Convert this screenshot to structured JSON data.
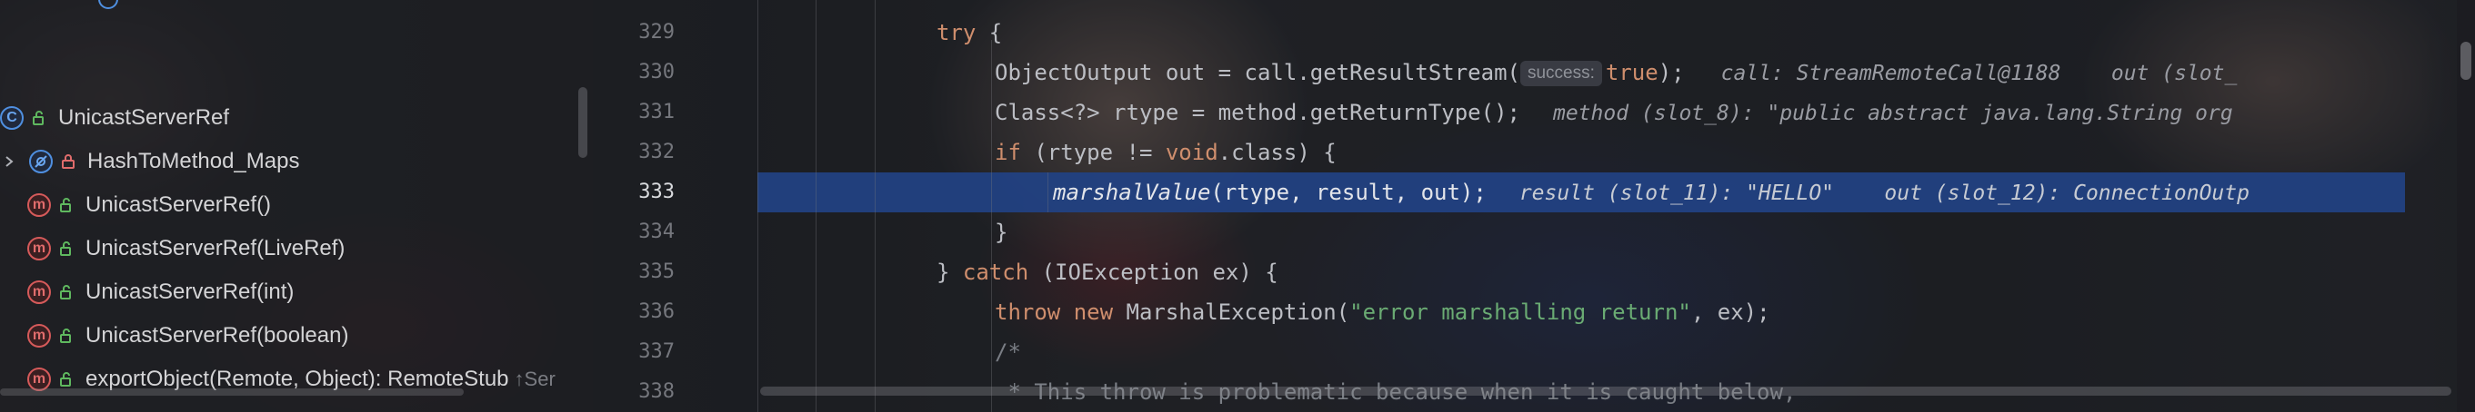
{
  "structure": {
    "top_partial_label": "",
    "items": [
      {
        "kind": "class",
        "badge": "C",
        "label": "UnicastServerRef",
        "suffix": "",
        "chevron": false
      },
      {
        "kind": "field",
        "badge": "f",
        "label": "HashToMethod_Maps",
        "suffix": "",
        "chevron": true
      },
      {
        "kind": "method",
        "badge": "m",
        "label": "UnicastServerRef()",
        "suffix": "",
        "chevron": false
      },
      {
        "kind": "method",
        "badge": "m",
        "label": "UnicastServerRef(LiveRef)",
        "suffix": "",
        "chevron": false
      },
      {
        "kind": "method",
        "badge": "m",
        "label": "UnicastServerRef(int)",
        "suffix": "",
        "chevron": false
      },
      {
        "kind": "method",
        "badge": "m",
        "label": "UnicastServerRef(boolean)",
        "suffix": "",
        "chevron": false
      },
      {
        "kind": "method",
        "badge": "m",
        "label": "exportObject(Remote, Object): RemoteStub",
        "suffix": "↑Ser",
        "chevron": false
      }
    ]
  },
  "editor": {
    "line_numbers": [
      "329",
      "330",
      "331",
      "332",
      "333",
      "334",
      "335",
      "336",
      "337",
      "338"
    ],
    "active_line": "333",
    "lines": {
      "l329": {
        "kw": "try",
        "rest": " {"
      },
      "l330": {
        "code": "ObjectOutput out = call.getResultStream(",
        "hint": "success:",
        "kw": "true",
        "tail": ");",
        "debug": "call: StreamRemoteCall@1188    out (slot_"
      },
      "l331": {
        "code": "Class<?> rtype = method.getReturnType();",
        "debug": "method (slot_8): \"public abstract java.lang.String org"
      },
      "l332": {
        "kw1": "if",
        "mid": " (rtype != ",
        "kw2": "void",
        "end": ".class) {"
      },
      "l333": {
        "method": "marshalValue",
        "args": "(rtype, result, out);",
        "debug": "result (slot_11): \"HELLO\"    out (slot_12): ConnectionOutp"
      },
      "l334": {
        "text": "}"
      },
      "l335": {
        "close": "} ",
        "kw": "catch",
        "rest": " (IOException ex) {"
      },
      "l336": {
        "kw1": "throw",
        "kw2": "new",
        "mid": " MarshalException(",
        "str": "\"error marshalling return\"",
        "end": ", ex);"
      },
      "l337": {
        "text": "/*"
      },
      "l338": {
        "text": " * This throw is problematic because when it is caught below,"
      }
    }
  },
  "colors": {
    "keyword": "#cf8e6d",
    "string": "#6aab73",
    "comment": "#7a7e85",
    "highlight": "#214283",
    "method_badge": "#d65a5a",
    "class_badge": "#4f8fe0"
  }
}
